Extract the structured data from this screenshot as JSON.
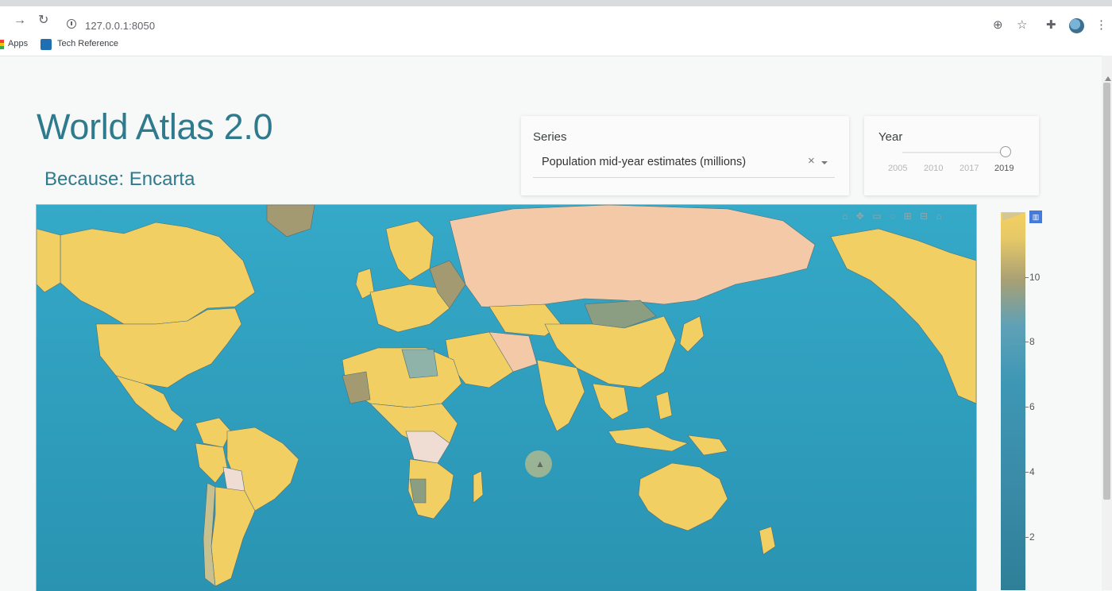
{
  "browser": {
    "url": "127.0.0.1:8050",
    "bookmarks": [
      "Apps",
      "Tech Reference"
    ]
  },
  "page": {
    "title": "World Atlas 2.0",
    "subtitle": "Because: Encarta"
  },
  "series_control": {
    "label": "Series",
    "selected": "Population mid-year estimates (millions)"
  },
  "year_control": {
    "label": "Year",
    "marks": [
      "2005",
      "2010",
      "2017",
      "2019"
    ],
    "selected": "2019"
  },
  "colorbar": {
    "ticks": [
      "10",
      "8",
      "6",
      "4",
      "2"
    ],
    "colors": {
      "high": "#f4d060",
      "mid": "#5fa1b7",
      "low": "#2e7f98"
    }
  },
  "map": {
    "ocean_color": "#2fa3c4",
    "land_high_color": "#f2cf63",
    "land_mid_color": "#8c9e82",
    "land_low_color": "#f4c9a8"
  }
}
